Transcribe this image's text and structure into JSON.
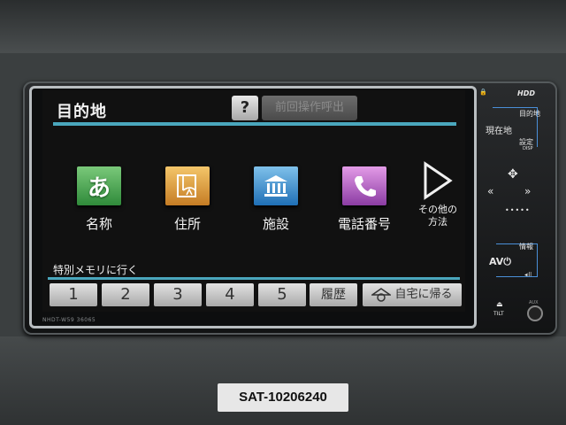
{
  "screen": {
    "title": "目的地",
    "help_label": "?",
    "prev_label": "前回操作呼出",
    "categories": [
      {
        "label": "名称",
        "icon": "hiragana-a-icon",
        "glyph": "あ",
        "color": "#3f9a48"
      },
      {
        "label": "住所",
        "icon": "address-map-icon",
        "glyph": "",
        "color": "#d9952f"
      },
      {
        "label": "施設",
        "icon": "facility-building-icon",
        "glyph": "",
        "color": "#2d7fc6"
      },
      {
        "label": "電話番号",
        "icon": "phone-icon",
        "glyph": "",
        "color": "#a24cc0"
      }
    ],
    "other_label_line1": "その他の",
    "other_label_line2": "方法",
    "memory_label": "特別メモリに行く",
    "memory_buttons": [
      "1",
      "2",
      "3",
      "4",
      "5"
    ],
    "history_label": "履歴",
    "home_label": "自宅に帰る"
  },
  "hardware": {
    "model_text": "NHDT-W59  36065",
    "hdd_label": "HDD",
    "destination_label": "目的地",
    "current_location_label": "現在地",
    "settings_label": "設定",
    "disp_label": "DISP",
    "info_label": "情報",
    "av_label": "AV",
    "tilt_label": "TILT",
    "aux_label": "AUX"
  },
  "watermark": {
    "plate_text": "SAT-10206240"
  }
}
